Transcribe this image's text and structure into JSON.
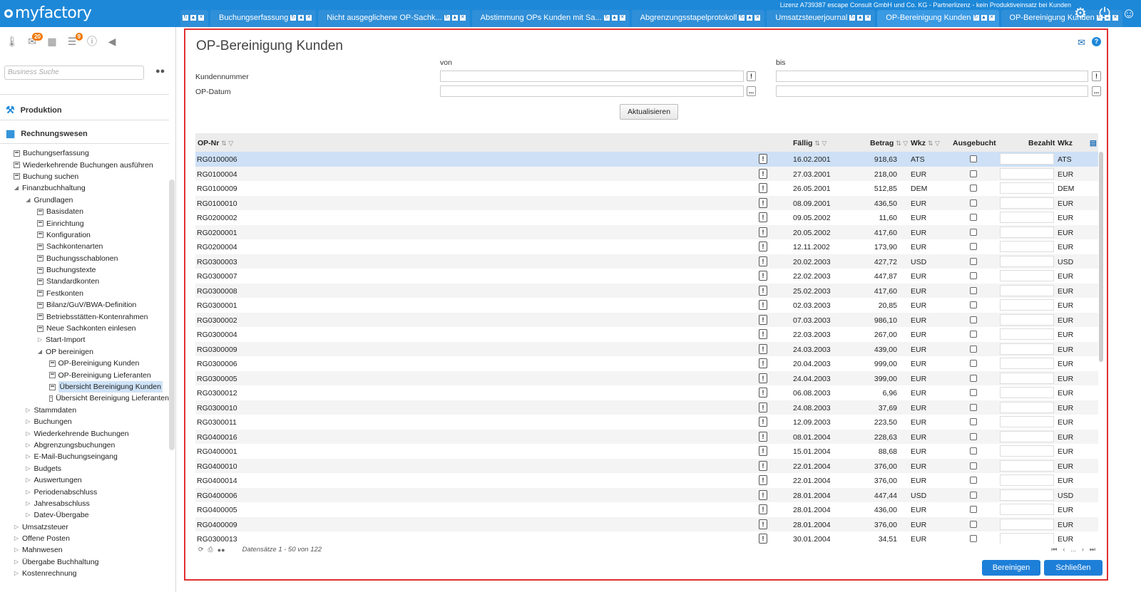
{
  "app": {
    "logo": "myfactory",
    "license": "Lizenz A739387 escape Consult GmbH und Co. KG - Partnerlizenz - kein Produktiveinsatz bei Kunden"
  },
  "tabs": [
    {
      "label": ""
    },
    {
      "label": "Buchungserfassung"
    },
    {
      "label": "Nicht ausgeglichene OP-Sachk..."
    },
    {
      "label": "Abstimmung OPs Kunden mit Sa..."
    },
    {
      "label": "Abgrenzungsstapelprotokoll"
    },
    {
      "label": "Umsatzsteuerjournal"
    },
    {
      "label": "OP-Bereinigung Kunden"
    },
    {
      "label": "OP-Bereinigung Kunden"
    }
  ],
  "sidebar": {
    "badge_1": "20",
    "badge_2": "9",
    "search_placeholder": "Business Suche",
    "sections": [
      {
        "label": "Produktion"
      },
      {
        "label": "Rechnungswesen"
      }
    ],
    "tree": [
      {
        "label": "Buchungserfassung",
        "level": 1,
        "type": "doc"
      },
      {
        "label": "Wiederkehrende Buchungen ausführen",
        "level": 1,
        "type": "doc"
      },
      {
        "label": "Buchung suchen",
        "level": 1,
        "type": "doc"
      },
      {
        "label": "Finanzbuchhaltung",
        "level": 1,
        "type": "open"
      },
      {
        "label": "Grundlagen",
        "level": 2,
        "type": "open"
      },
      {
        "label": "Basisdaten",
        "level": 3,
        "type": "doc"
      },
      {
        "label": "Einrichtung",
        "level": 3,
        "type": "doc"
      },
      {
        "label": "Konfiguration",
        "level": 3,
        "type": "doc"
      },
      {
        "label": "Sachkontenarten",
        "level": 3,
        "type": "doc"
      },
      {
        "label": "Buchungsschablonen",
        "level": 3,
        "type": "doc"
      },
      {
        "label": "Buchungstexte",
        "level": 3,
        "type": "doc"
      },
      {
        "label": "Standardkonten",
        "level": 3,
        "type": "doc"
      },
      {
        "label": "Festkonten",
        "level": 3,
        "type": "doc"
      },
      {
        "label": "Bilanz/GuV/BWA-Definition",
        "level": 3,
        "type": "doc"
      },
      {
        "label": "Betriebsstätten-Kontenrahmen",
        "level": 3,
        "type": "doc"
      },
      {
        "label": "Neue Sachkonten einlesen",
        "level": 3,
        "type": "doc"
      },
      {
        "label": "Start-Import",
        "level": 3,
        "type": "closed"
      },
      {
        "label": "OP bereinigen",
        "level": 3,
        "type": "open"
      },
      {
        "label": "OP-Bereinigung Kunden",
        "level": 4,
        "type": "doc"
      },
      {
        "label": "OP-Bereinigung Lieferanten",
        "level": 4,
        "type": "doc"
      },
      {
        "label": "Übersicht Bereinigung Kunden",
        "level": 4,
        "type": "doc",
        "selected": true
      },
      {
        "label": "Übersicht Bereinigung Lieferanten",
        "level": 4,
        "type": "doc"
      },
      {
        "label": "Stammdaten",
        "level": 2,
        "type": "closed"
      },
      {
        "label": "Buchungen",
        "level": 2,
        "type": "closed"
      },
      {
        "label": "Wiederkehrende Buchungen",
        "level": 2,
        "type": "closed"
      },
      {
        "label": "Abgrenzungsbuchungen",
        "level": 2,
        "type": "closed"
      },
      {
        "label": "E-Mail-Buchungseingang",
        "level": 2,
        "type": "closed"
      },
      {
        "label": "Budgets",
        "level": 2,
        "type": "closed"
      },
      {
        "label": "Auswertungen",
        "level": 2,
        "type": "closed"
      },
      {
        "label": "Periodenabschluss",
        "level": 2,
        "type": "closed"
      },
      {
        "label": "Jahresabschluss",
        "level": 2,
        "type": "closed"
      },
      {
        "label": "Datev-Übergabe",
        "level": 2,
        "type": "closed"
      },
      {
        "label": "Umsatzsteuer",
        "level": 1,
        "type": "closed"
      },
      {
        "label": "Offene Posten",
        "level": 1,
        "type": "closed"
      },
      {
        "label": "Mahnwesen",
        "level": 1,
        "type": "closed"
      },
      {
        "label": "Übergabe Buchhaltung",
        "level": 1,
        "type": "closed"
      },
      {
        "label": "Kostenrechnung",
        "level": 1,
        "type": "closed"
      }
    ]
  },
  "form": {
    "title": "OP-Bereinigung Kunden",
    "von_label": "von",
    "bis_label": "bis",
    "kundennummer_label": "Kundennummer",
    "opdatum_label": "OP-Datum",
    "bang": "!",
    "dots": "...",
    "aktualisieren": "Aktualisieren"
  },
  "table": {
    "headers": {
      "opnr": "OP-Nr",
      "faellig": "Fällig",
      "betrag": "Betrag",
      "wkz": "Wkz",
      "ausgebucht": "Ausgebucht",
      "bezahlt": "Bezahlt",
      "wkz2": "Wkz"
    },
    "rows": [
      {
        "opnr": "RG0100006",
        "faellig": "16.02.2001",
        "betrag": "918,63",
        "wkz": "ATS"
      },
      {
        "opnr": "RG0100004",
        "faellig": "27.03.2001",
        "betrag": "218,00",
        "wkz": "EUR"
      },
      {
        "opnr": "RG0100009",
        "faellig": "26.05.2001",
        "betrag": "512,85",
        "wkz": "DEM"
      },
      {
        "opnr": "RG0100010",
        "faellig": "08.09.2001",
        "betrag": "436,50",
        "wkz": "EUR"
      },
      {
        "opnr": "RG0200002",
        "faellig": "09.05.2002",
        "betrag": "11,60",
        "wkz": "EUR"
      },
      {
        "opnr": "RG0200001",
        "faellig": "20.05.2002",
        "betrag": "417,60",
        "wkz": "EUR"
      },
      {
        "opnr": "RG0200004",
        "faellig": "12.11.2002",
        "betrag": "173,90",
        "wkz": "EUR"
      },
      {
        "opnr": "RG0300003",
        "faellig": "20.02.2003",
        "betrag": "427,72",
        "wkz": "USD"
      },
      {
        "opnr": "RG0300007",
        "faellig": "22.02.2003",
        "betrag": "447,87",
        "wkz": "EUR"
      },
      {
        "opnr": "RG0300008",
        "faellig": "25.02.2003",
        "betrag": "417,60",
        "wkz": "EUR"
      },
      {
        "opnr": "RG0300001",
        "faellig": "02.03.2003",
        "betrag": "20,85",
        "wkz": "EUR"
      },
      {
        "opnr": "RG0300002",
        "faellig": "07.03.2003",
        "betrag": "986,10",
        "wkz": "EUR"
      },
      {
        "opnr": "RG0300004",
        "faellig": "22.03.2003",
        "betrag": "267,00",
        "wkz": "EUR"
      },
      {
        "opnr": "RG0300009",
        "faellig": "24.03.2003",
        "betrag": "439,00",
        "wkz": "EUR"
      },
      {
        "opnr": "RG0300006",
        "faellig": "20.04.2003",
        "betrag": "999,00",
        "wkz": "EUR"
      },
      {
        "opnr": "RG0300005",
        "faellig": "24.04.2003",
        "betrag": "399,00",
        "wkz": "EUR"
      },
      {
        "opnr": "RG0300012",
        "faellig": "06.08.2003",
        "betrag": "6,96",
        "wkz": "EUR"
      },
      {
        "opnr": "RG0300010",
        "faellig": "24.08.2003",
        "betrag": "37,69",
        "wkz": "EUR"
      },
      {
        "opnr": "RG0300011",
        "faellig": "12.09.2003",
        "betrag": "223,50",
        "wkz": "EUR"
      },
      {
        "opnr": "RG0400016",
        "faellig": "08.01.2004",
        "betrag": "228,63",
        "wkz": "EUR"
      },
      {
        "opnr": "RG0400001",
        "faellig": "15.01.2004",
        "betrag": "88,68",
        "wkz": "EUR"
      },
      {
        "opnr": "RG0400010",
        "faellig": "22.01.2004",
        "betrag": "376,00",
        "wkz": "EUR"
      },
      {
        "opnr": "RG0400014",
        "faellig": "22.01.2004",
        "betrag": "376,00",
        "wkz": "EUR"
      },
      {
        "opnr": "RG0400006",
        "faellig": "28.01.2004",
        "betrag": "447,44",
        "wkz": "USD"
      },
      {
        "opnr": "RG0400005",
        "faellig": "28.01.2004",
        "betrag": "436,00",
        "wkz": "EUR"
      },
      {
        "opnr": "RG0400009",
        "faellig": "28.01.2004",
        "betrag": "376,00",
        "wkz": "EUR"
      },
      {
        "opnr": "RG0300013",
        "faellig": "30.01.2004",
        "betrag": "34,51",
        "wkz": "EUR"
      }
    ],
    "footer": "Datensätze 1 - 50 von 122",
    "pager_ellipsis": "..."
  },
  "buttons": {
    "bereinigen": "Bereinigen",
    "schliessen": "Schließen"
  },
  "colors": {
    "brand": "#1e88d8",
    "panel_border": "#e03030",
    "button": "#1e7fd8",
    "selection": "#cde0f6"
  }
}
